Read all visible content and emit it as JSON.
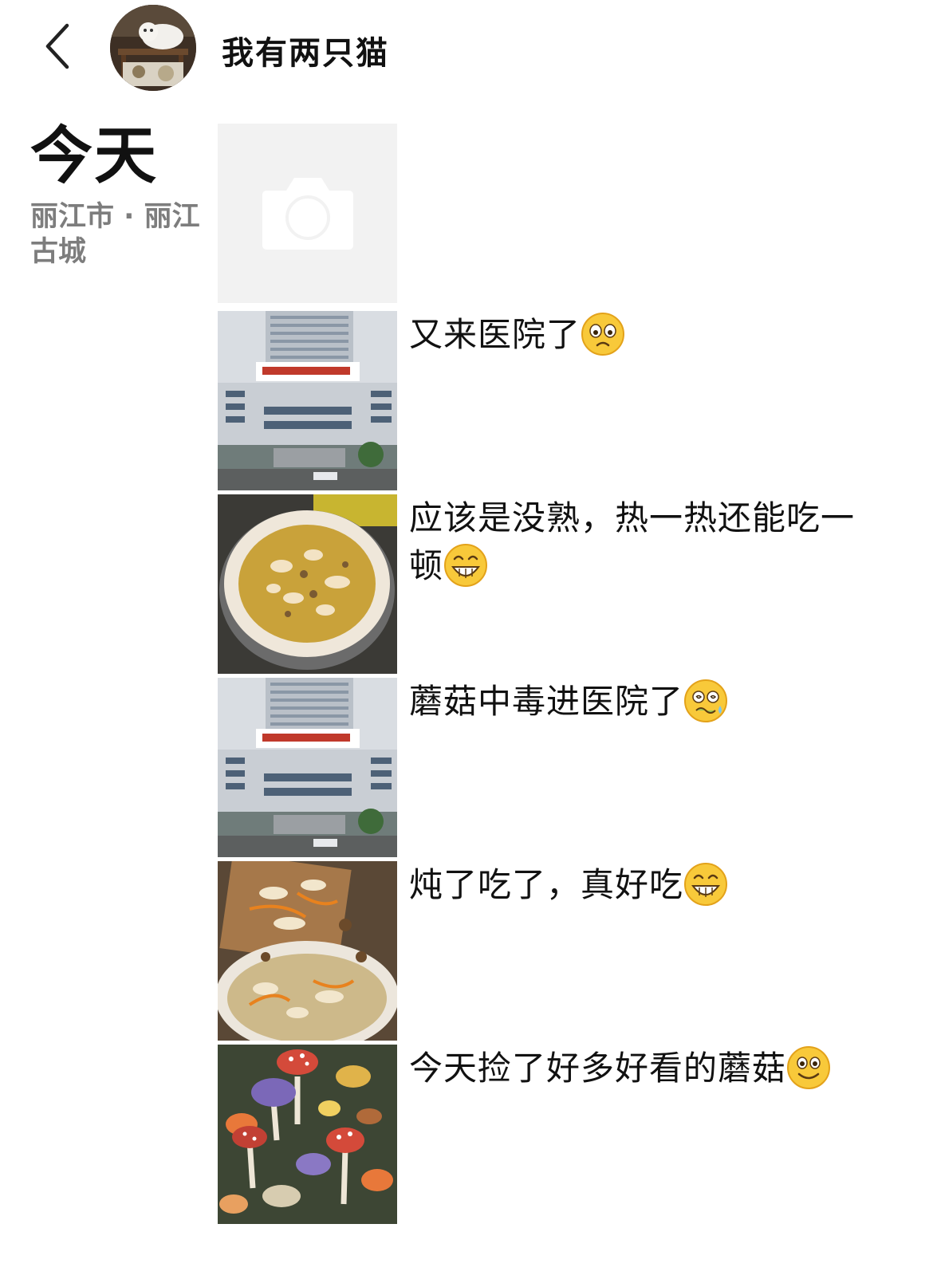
{
  "header": {
    "back_icon": "chevron-left-icon",
    "username": "我有两只猫"
  },
  "date_block": {
    "day_label": "今天",
    "location": "丽江市 · 丽江古城"
  },
  "posts": [
    {
      "type": "photo-placeholder",
      "caption": ""
    },
    {
      "type": "photo",
      "caption": "又来医院了",
      "emoji": "worried-face-emoji",
      "image_subject": "hospital-building"
    },
    {
      "type": "photo",
      "caption": "应该是没熟，热一热还能吃一顿",
      "emoji": "grinning-face-emoji",
      "image_subject": "mushroom-soup"
    },
    {
      "type": "photo",
      "caption": "蘑菇中毒进医院了",
      "emoji": "dizzy-sweat-face-emoji",
      "image_subject": "hospital-building"
    },
    {
      "type": "photo",
      "caption": "炖了吃了，真好吃",
      "emoji": "grinning-face-emoji",
      "image_subject": "mushroom-stew"
    },
    {
      "type": "photo",
      "caption": "今天捡了好多好看的蘑菇",
      "emoji": "smiling-face-emoji",
      "image_subject": "wild-mushrooms"
    }
  ],
  "colors": {
    "text_primary": "#111111",
    "text_secondary": "#7d7d7d",
    "placeholder_bg": "#f1f1f1"
  }
}
